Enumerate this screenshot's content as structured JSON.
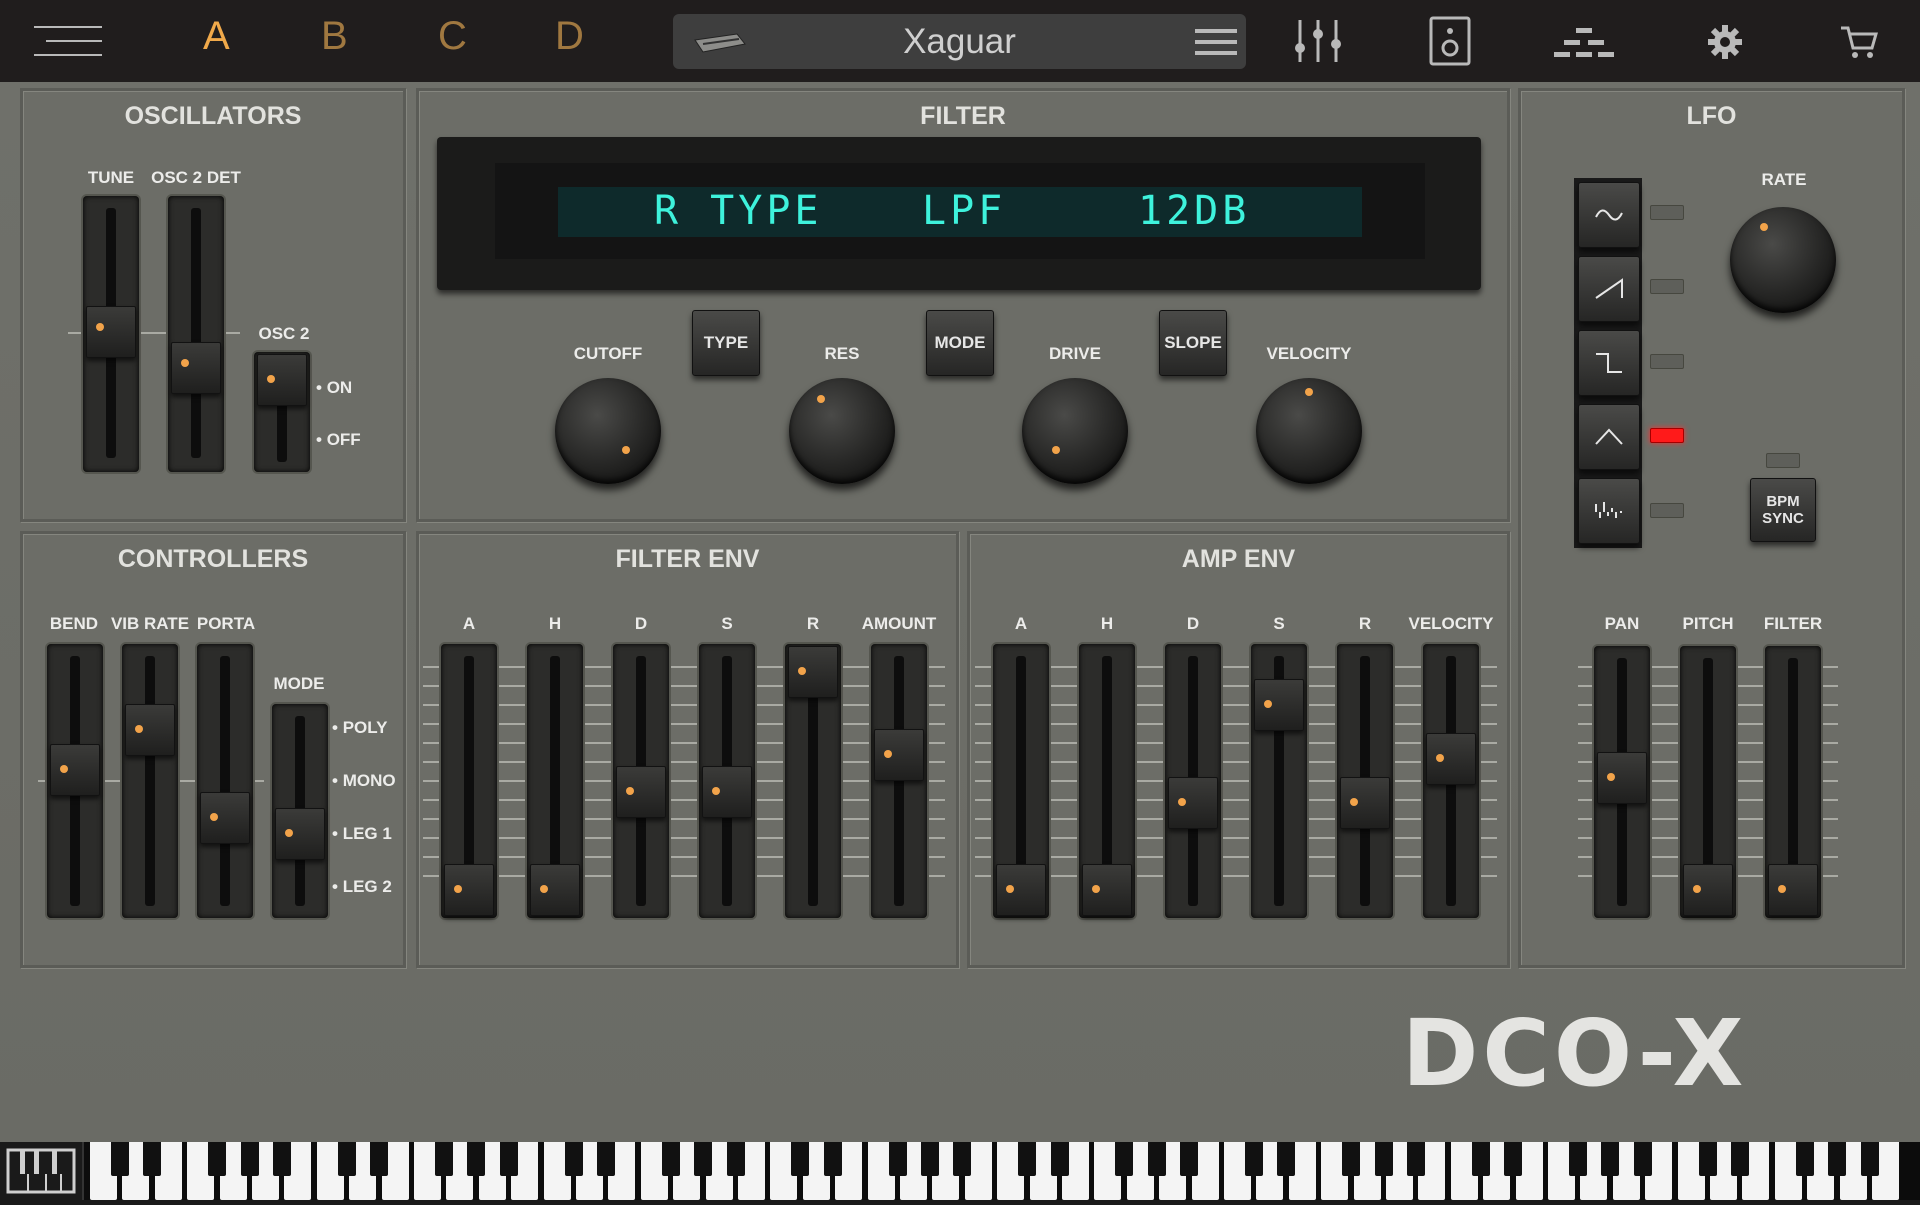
{
  "topbar": {
    "tabs": [
      "A",
      "B",
      "C",
      "D"
    ],
    "preset_name": "Xaguar",
    "icons": [
      "hamburger-menu-icon",
      "keyboard-preset-icon",
      "list-menu-icon",
      "mixer-icon",
      "speaker-icon",
      "sequencer-icon",
      "gear-icon",
      "cart-icon"
    ]
  },
  "oscillators": {
    "title": "OSCILLATORS",
    "labels": {
      "tune": "TUNE",
      "osc2det": "OSC 2 DET",
      "osc2": "OSC 2"
    },
    "osc2_options": [
      "ON",
      "OFF"
    ],
    "tune_level": 0.5,
    "osc2det_level": 0.38,
    "osc2_state": "ON"
  },
  "filter": {
    "title": "FILTER",
    "display": {
      "type": "R TYPE",
      "mode": "LPF",
      "slope": "12DB"
    },
    "knobs": [
      "CUTOFF",
      "RES",
      "DRIVE",
      "VELOCITY"
    ],
    "buttons": [
      "TYPE",
      "MODE",
      "SLOPE"
    ]
  },
  "lfo": {
    "title": "LFO",
    "rate_label": "RATE",
    "waveforms": [
      "sine-wave-icon",
      "saw-wave-icon",
      "square-wave-icon",
      "triangle-wave-icon",
      "random-wave-icon"
    ],
    "active_waveform": "triangle-wave-icon",
    "bpm_sync": "BPM SYNC",
    "sliders": [
      "PAN",
      "PITCH",
      "FILTER"
    ],
    "slider_levels": [
      0.5,
      0.0,
      0.0
    ]
  },
  "controllers": {
    "title": "CONTROLLERS",
    "labels": [
      "BEND",
      "VIB RATE",
      "PORTA"
    ],
    "mode_label": "MODE",
    "mode_options": [
      "POLY",
      "MONO",
      "LEG 1",
      "LEG 2"
    ],
    "levels": [
      0.5,
      0.72,
      0.35
    ],
    "mode_state": "LEG 1"
  },
  "filter_env": {
    "title": "FILTER ENV",
    "labels": [
      "A",
      "H",
      "D",
      "S",
      "R",
      "AMOUNT"
    ],
    "levels": [
      0.0,
      0.0,
      0.45,
      0.45,
      1.0,
      0.62
    ]
  },
  "amp_env": {
    "title": "AMP ENV",
    "labels": [
      "A",
      "H",
      "D",
      "S",
      "R",
      "VELOCITY"
    ],
    "levels": [
      0.0,
      0.0,
      0.4,
      0.85,
      0.4,
      0.6
    ]
  },
  "brand": {
    "logo": "DCO-X"
  },
  "colors": {
    "accent_tab": "#f0a94a",
    "inactive_tab": "#a07840",
    "lcd": "#3ef2dc",
    "led_on": "#ff1a1a",
    "knob_dot": "#f2a34a"
  }
}
